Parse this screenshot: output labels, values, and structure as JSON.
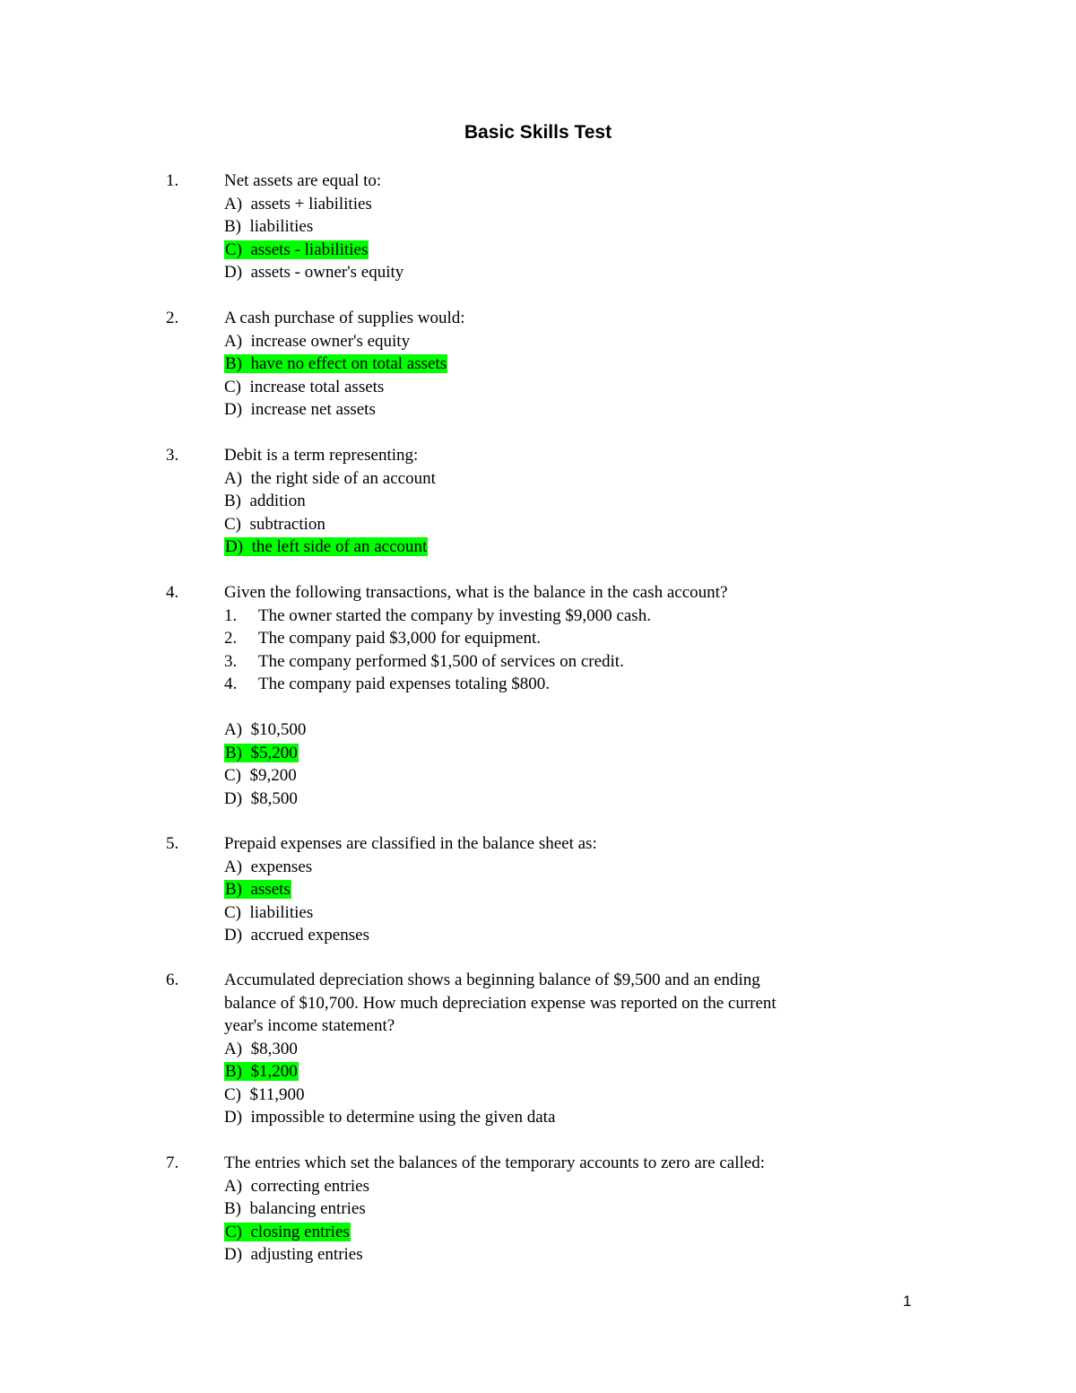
{
  "title": "Basic Skills Test",
  "page_number": "1",
  "highlight_color": "#00ff00",
  "questions": [
    {
      "number": "1.",
      "text": "Net assets are equal to:",
      "options": [
        {
          "label": "A)",
          "text": "assets + liabilities",
          "correct": false
        },
        {
          "label": "B)",
          "text": "liabilities",
          "correct": false
        },
        {
          "label": "C)",
          "text": "assets - liabilities",
          "correct": true
        },
        {
          "label": "D)",
          "text": "assets - owner's equity",
          "correct": false
        }
      ]
    },
    {
      "number": "2.",
      "text": "A cash purchase of supplies would:",
      "options": [
        {
          "label": "A)",
          "text": "increase owner's equity",
          "correct": false
        },
        {
          "label": "B)",
          "text": "have no effect on total assets",
          "correct": true
        },
        {
          "label": "C)",
          "text": "increase total assets",
          "correct": false
        },
        {
          "label": "D)",
          "text": "increase net assets",
          "correct": false
        }
      ]
    },
    {
      "number": "3.",
      "text": "Debit is a term representing:",
      "options": [
        {
          "label": "A)",
          "text": "the right side of an account",
          "correct": false
        },
        {
          "label": "B)",
          "text": "addition",
          "correct": false
        },
        {
          "label": "C)",
          "text": "subtraction",
          "correct": false
        },
        {
          "label": "D)",
          "text": "the left side of an account",
          "correct": true
        }
      ]
    },
    {
      "number": "4.",
      "text": "Given the following transactions, what is the balance in the cash account?",
      "transactions": [
        {
          "n": "1.",
          "text": "The owner started the company by investing $9,000 cash."
        },
        {
          "n": "2.",
          "text": "The company paid $3,000 for equipment."
        },
        {
          "n": "3.",
          "text": "The company performed $1,500 of services on credit."
        },
        {
          "n": "4.",
          "text": "The company paid expenses totaling $800."
        }
      ],
      "options": [
        {
          "label": "A)",
          "text": "$10,500",
          "correct": false
        },
        {
          "label": "B)",
          "text": "$5,200",
          "correct": true
        },
        {
          "label": "C)",
          "text": "$9,200",
          "correct": false
        },
        {
          "label": "D)",
          "text": "$8,500",
          "correct": false
        }
      ]
    },
    {
      "number": "5.",
      "text": "Prepaid expenses are classified in the balance sheet as:",
      "options": [
        {
          "label": "A)",
          "text": "expenses",
          "correct": false
        },
        {
          "label": "B)",
          "text": "assets",
          "correct": true
        },
        {
          "label": "C)",
          "text": "liabilities",
          "correct": false
        },
        {
          "label": "D)",
          "text": "accrued expenses",
          "correct": false
        }
      ]
    },
    {
      "number": "6.",
      "text_lines": [
        "Accumulated depreciation shows a beginning balance of $9,500 and an ending",
        "balance of $10,700. How much depreciation expense was reported on the current",
        "year's income statement?"
      ],
      "options": [
        {
          "label": "A)",
          "text": "$8,300",
          "correct": false
        },
        {
          "label": "B)",
          "text": "$1,200",
          "correct": true
        },
        {
          "label": "C)",
          "text": "$11,900",
          "correct": false
        },
        {
          "label": "D)",
          "text": "impossible to determine using the given data",
          "correct": false
        }
      ]
    },
    {
      "number": "7.",
      "text": "The entries which set the balances of the temporary accounts to zero are called:",
      "options": [
        {
          "label": "A)",
          "text": "correcting entries",
          "correct": false
        },
        {
          "label": "B)",
          "text": "balancing entries",
          "correct": false
        },
        {
          "label": "C)",
          "text": "closing entries",
          "correct": true
        },
        {
          "label": "D)",
          "text": "adjusting entries",
          "correct": false
        }
      ]
    }
  ]
}
